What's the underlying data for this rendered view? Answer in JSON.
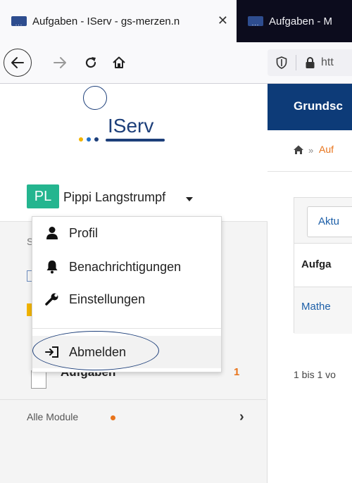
{
  "browser": {
    "tabs": [
      {
        "title": "Aufgaben - IServ - gs-merzen.n",
        "favicon": "...",
        "close": "✕",
        "active": true
      },
      {
        "title": "Aufgaben - M",
        "favicon": "...",
        "active": false
      }
    ],
    "url_visible": "htt"
  },
  "sidebar": {
    "logo_text": "IServ",
    "logo_dots_colors": [
      "#f2b400",
      "#1d6fc9",
      "#1d3f7a"
    ],
    "user": {
      "initials": "PL",
      "name": "Pippi Langstrumpf"
    },
    "partial_label": "S",
    "aufgaben_label": "Aufgaben",
    "aufgaben_badge": "1",
    "alle_module_label": "Alle Module"
  },
  "dropdown": {
    "items": [
      {
        "label": "Profil",
        "icon": "user-icon"
      },
      {
        "label": "Benachrichtigungen",
        "icon": "bell-icon"
      },
      {
        "label": "Einstellungen",
        "icon": "wrench-icon"
      },
      {
        "label": "Abmelden",
        "icon": "sign-out-icon"
      }
    ]
  },
  "main": {
    "header_title": "Grundsc",
    "breadcrumb_sep": "»",
    "breadcrumb_link": "Auf",
    "action_button": "Aktu",
    "table_header": "Aufga",
    "table_link": "Mathe",
    "pager": "1 bis 1 vo"
  },
  "colors": {
    "accent_dark_blue": "#0d3b78",
    "accent_orange": "#e8731a",
    "avatar_green": "#24b58f"
  }
}
